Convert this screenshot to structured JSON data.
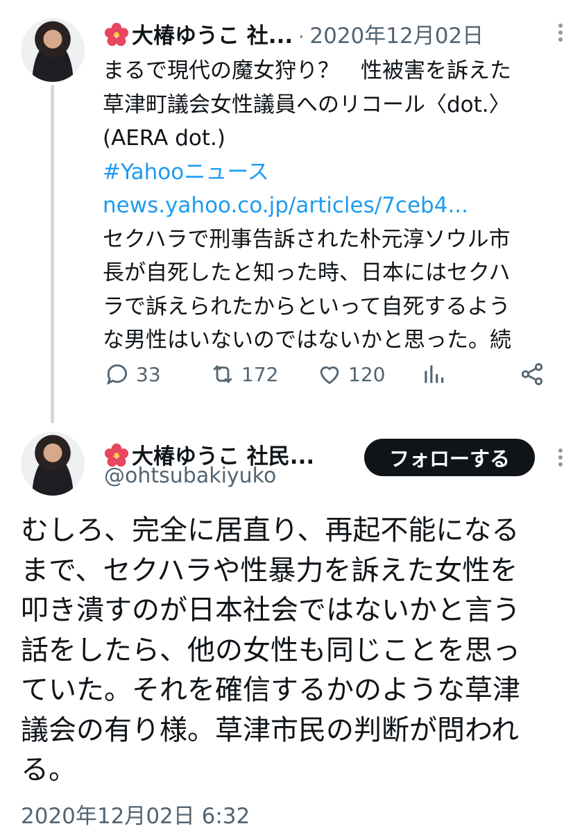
{
  "tweet1": {
    "display_name": "大椿ゆうこ 社...",
    "separator": "·",
    "date": "2020年12月02日",
    "text_lines": [
      "まるで現代の魔女狩り？　性被害を訴えた",
      "草津町議会女性議員へのリコール〈dot.〉",
      "(AERA dot.)"
    ],
    "hashtag": "#Yahooニュース",
    "link": "news.yahoo.co.jp/articles/7ceb4...",
    "text_lines_2": [
      "セクハラで刑事告訴された朴元淳ソウル市",
      "長が自死したと知った時、日本にはセクハ",
      "ラで訴えられたからといって自死するよう",
      "な男性はいないのではないかと思った。続"
    ],
    "counts": {
      "replies": "33",
      "retweets": "172",
      "likes": "120"
    }
  },
  "tweet2": {
    "display_name": "大椿ゆうこ 社民...",
    "handle": "@ohtsubakiyuko",
    "follow_label": "フォローする",
    "text_lines": [
      "むしろ、完全に居直り、再起不能になる",
      "まで、セクハラや性暴力を訴えた女性を",
      "叩き潰すのが日本社会ではないかと言う",
      "話をしたら、他の女性も同じことを思っ",
      "ていた。それを確信するかのような草津",
      "議会の有り様。草津市民の判断が問われ",
      "る。"
    ],
    "timestamp": "2020年12月02日 6:32"
  },
  "colors": {
    "link": "#1d9bf0",
    "muted": "#536471",
    "button": "#0f1419"
  },
  "icons": [
    "hibiscus-icon",
    "more-icon",
    "reply-icon",
    "retweet-icon",
    "like-icon",
    "views-icon",
    "share-icon"
  ]
}
